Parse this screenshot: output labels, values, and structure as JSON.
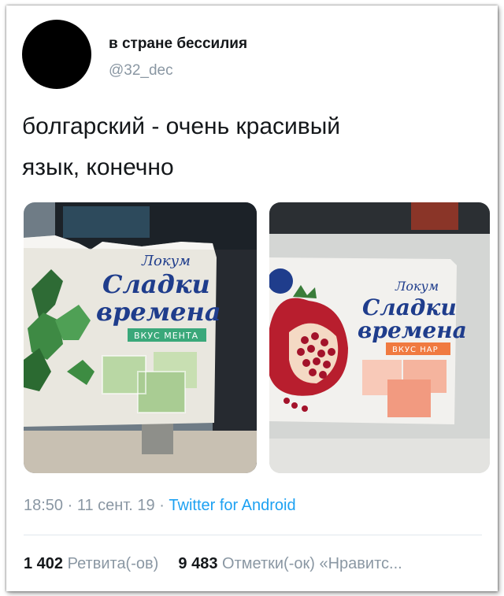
{
  "tweet": {
    "display_name": "в стране бессилия",
    "handle": "@32_dec",
    "text_line1": "болгарский - очень красивый",
    "text_line2": "язык, конечно",
    "time": "18:50",
    "date": "11 сент. 19",
    "source": "Twitter for Android",
    "sep": " · "
  },
  "stats": {
    "retweets_count": "1 402",
    "retweets_label": "Ретвита(-ов)",
    "likes_count": "9 483",
    "likes_label": "Отметки(-ок) «Нравитс..."
  },
  "photos": {
    "left": {
      "brand_small": "Локум",
      "brand_line1": "Сладки",
      "brand_line2": "времена",
      "flavor": "ВКУС МЕНТА"
    },
    "right": {
      "brand_small": "Локум",
      "brand_line1": "Сладки",
      "brand_line2": "времена",
      "flavor": "ВКУС НАР"
    }
  },
  "colors": {
    "link": "#1da1f2",
    "muted": "#8a97a3",
    "mint_badge": "#3aa87a",
    "pomegranate_badge": "#f07a40",
    "brand_blue": "#1f3d8c"
  }
}
